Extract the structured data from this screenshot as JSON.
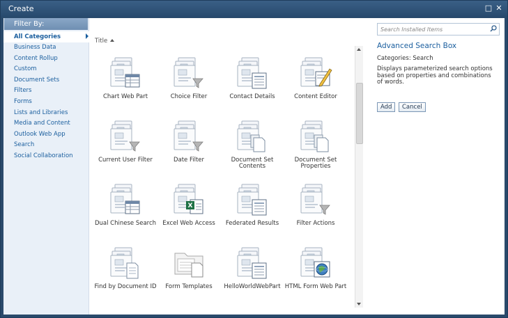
{
  "window": {
    "title": "Create",
    "max_glyph": "□",
    "close_glyph": "✕"
  },
  "sidebar": {
    "header": "Filter By:",
    "items": [
      {
        "label": "All Categories",
        "selected": true
      },
      {
        "label": "Business Data"
      },
      {
        "label": "Content Rollup"
      },
      {
        "label": "Custom"
      },
      {
        "label": "Document Sets"
      },
      {
        "label": "Filters"
      },
      {
        "label": "Forms"
      },
      {
        "label": "Lists and Libraries"
      },
      {
        "label": "Media and Content"
      },
      {
        "label": "Outlook Web App"
      },
      {
        "label": "Search"
      },
      {
        "label": "Social Collaboration"
      }
    ]
  },
  "list": {
    "column_header": "Title",
    "items": [
      {
        "label": "Chart Web Part",
        "icon": "chart-web-part-icon"
      },
      {
        "label": "Choice Filter",
        "icon": "choice-filter-icon"
      },
      {
        "label": "Contact Details",
        "icon": "contact-details-icon"
      },
      {
        "label": "Content Editor",
        "icon": "content-editor-icon"
      },
      {
        "label": "Current User Filter",
        "icon": "current-user-filter-icon"
      },
      {
        "label": "Date Filter",
        "icon": "date-filter-icon"
      },
      {
        "label": "Document Set Contents",
        "icon": "document-set-contents-icon"
      },
      {
        "label": "Document Set Properties",
        "icon": "document-set-properties-icon"
      },
      {
        "label": "Dual Chinese Search",
        "icon": "dual-chinese-search-icon"
      },
      {
        "label": "Excel Web Access",
        "icon": "excel-web-access-icon"
      },
      {
        "label": "Federated Results",
        "icon": "federated-results-icon"
      },
      {
        "label": "Filter Actions",
        "icon": "filter-actions-icon"
      },
      {
        "label": "Find by Document ID",
        "icon": "find-by-document-id-icon"
      },
      {
        "label": "Form Templates",
        "icon": "form-templates-icon"
      },
      {
        "label": "HelloWorldWebPart",
        "icon": "hello-world-web-part-icon"
      },
      {
        "label": "HTML Form Web Part",
        "icon": "html-form-web-part-icon"
      }
    ]
  },
  "search": {
    "placeholder": "Search Installed Items"
  },
  "details": {
    "title": "Advanced Search Box",
    "categories": "Categories: Search",
    "description": "Displays parameterized search options based on properties and combinations of words."
  },
  "buttons": {
    "add": "Add",
    "cancel": "Cancel"
  }
}
